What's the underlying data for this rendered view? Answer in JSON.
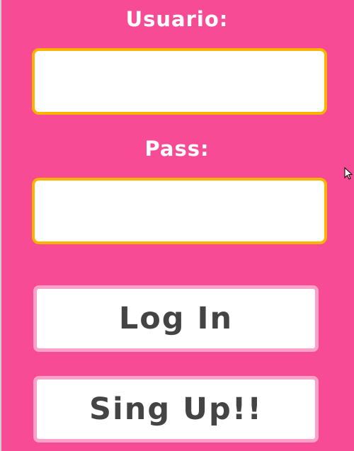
{
  "form": {
    "username_label": "Usuario:",
    "username_value": "",
    "password_label": "Pass:",
    "password_value": ""
  },
  "buttons": {
    "login_label": "Log In",
    "signup_label": "Sing Up!!"
  },
  "colors": {
    "background": "#f74c95",
    "field_border": "#ffb300",
    "button_border": "#f8a2c8",
    "button_text": "#444444",
    "label_text": "#ffffff"
  },
  "icons": {
    "pointer": "mouse-pointer-icon"
  }
}
